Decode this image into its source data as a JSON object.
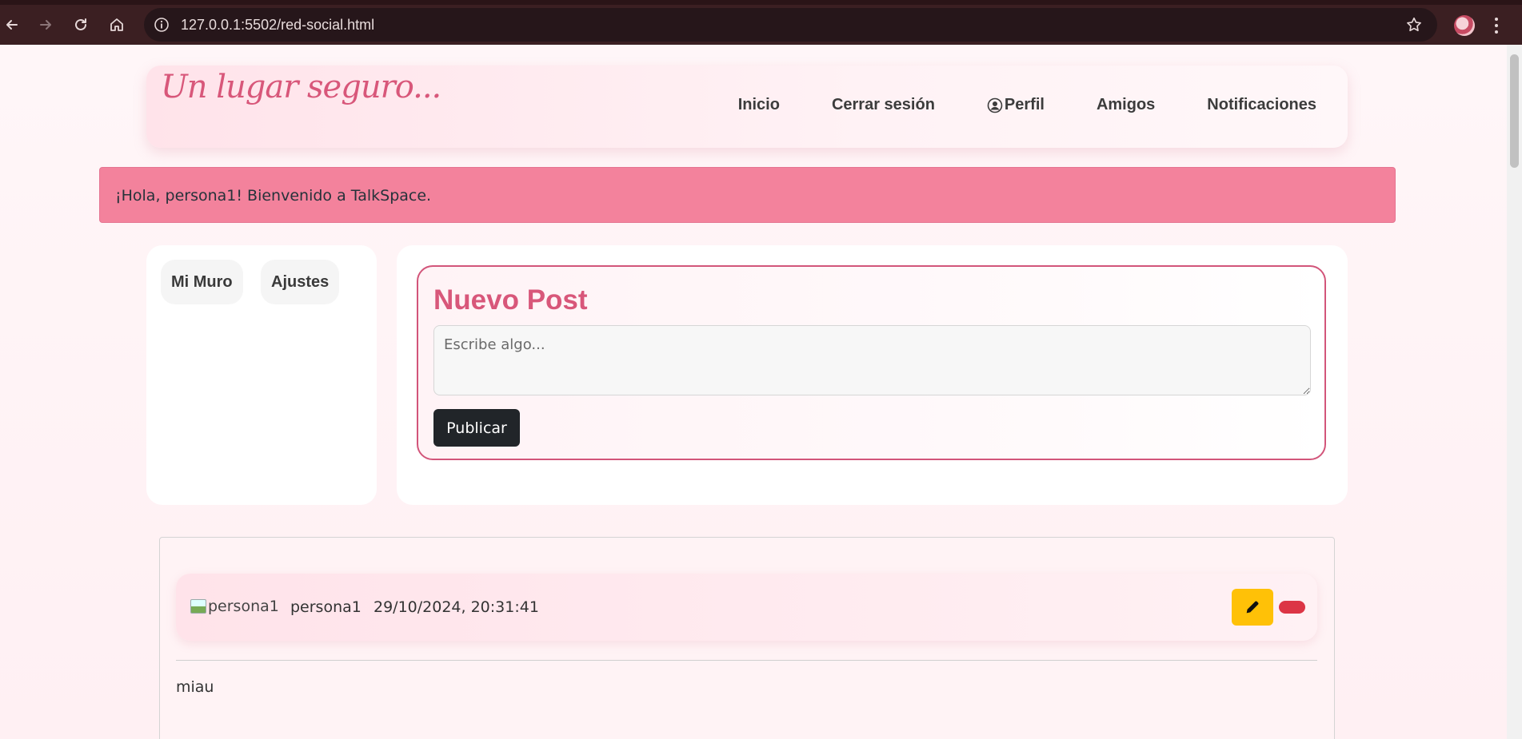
{
  "browser": {
    "url": "127.0.0.1:5502/red-social.html",
    "icons": [
      "back-icon",
      "forward-icon",
      "reload-icon",
      "home-icon",
      "site-info-icon",
      "bookmark-star-icon",
      "profile-avatar",
      "menu-dots-icon"
    ]
  },
  "header": {
    "logo": "Un lugar seguro...",
    "nav": [
      {
        "label": "Inicio"
      },
      {
        "label": "Cerrar sesión"
      },
      {
        "label": "Perfil",
        "icon": "user-circle-icon"
      },
      {
        "label": "Amigos"
      },
      {
        "label": "Notificaciones"
      }
    ]
  },
  "alert": {
    "text": "¡Hola, persona1! Bienvenido a TalkSpace."
  },
  "sidebar": {
    "items": [
      {
        "label": "Mi Muro"
      },
      {
        "label": "Ajustes"
      }
    ]
  },
  "new_post": {
    "title": "Nuevo Post",
    "placeholder": "Escribe algo...",
    "publish_label": "Publicar"
  },
  "posts": [
    {
      "avatar_alt": "persona1",
      "user": "persona1",
      "date": "29/10/2024, 20:31:41",
      "content": "miau",
      "edit_icon": "pencil-icon"
    }
  ],
  "colors": {
    "accent": "#d8577a",
    "alert_bg": "#f3829c",
    "edit": "#ffc107",
    "delete": "#dc3545",
    "dark_button": "#212529"
  }
}
